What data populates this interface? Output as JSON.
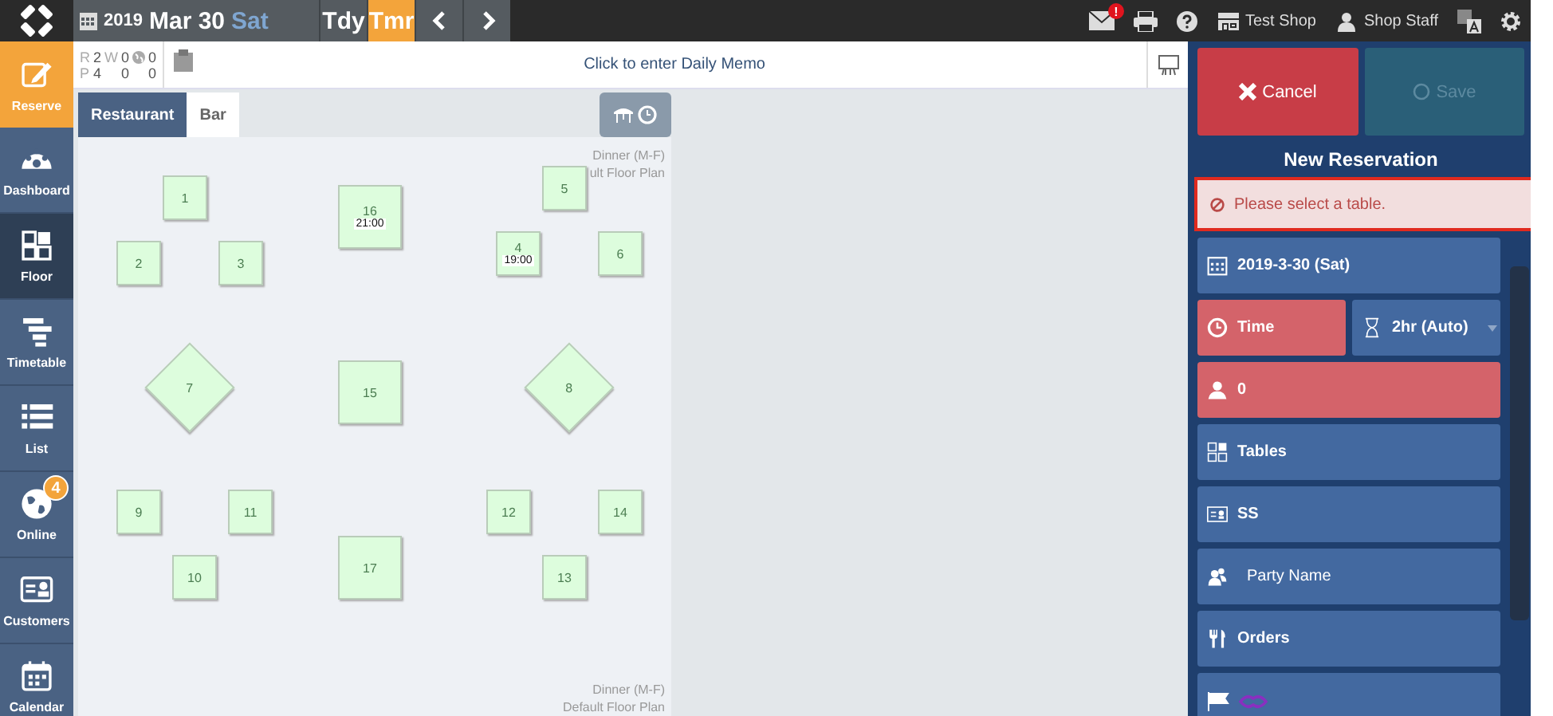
{
  "topbar": {
    "year": "2019",
    "date": "Mar 30",
    "weekday": "Sat",
    "nav": [
      {
        "label": "Tdy",
        "selected": false
      },
      {
        "label": "Tmr",
        "selected": true
      }
    ],
    "mail_badge": "!",
    "shop": "Test Shop",
    "staff": "Shop Staff"
  },
  "sidebar": {
    "reserve": "Reserve",
    "items": [
      {
        "label": "Dashboard",
        "selected": false
      },
      {
        "label": "Floor",
        "selected": true
      },
      {
        "label": "Timetable",
        "selected": false
      },
      {
        "label": "List",
        "selected": false
      },
      {
        "label": "Online",
        "selected": false,
        "badge": "4"
      },
      {
        "label": "Customers",
        "selected": false
      },
      {
        "label": "Calendar",
        "selected": false
      }
    ]
  },
  "stats": {
    "waiting_label": "W",
    "rows": [
      {
        "label": "R",
        "values": [
          "2",
          "0",
          "0"
        ]
      },
      {
        "label": "P",
        "values": [
          "4",
          "0",
          "0"
        ]
      }
    ]
  },
  "memo": {
    "text": "Click to enter Daily Memo"
  },
  "floor_tabs": [
    {
      "label": "Restaurant",
      "selected": true
    },
    {
      "label": "Bar",
      "selected": false
    }
  ],
  "floor_plan": {
    "top_labels": [
      "Dinner (M-F)",
      "ult Floor Plan"
    ],
    "bottom_labels": [
      "Dinner (M-F)",
      "Default Floor Plan"
    ],
    "tables": [
      {
        "label": "1",
        "kind": "square"
      },
      {
        "label": "2",
        "kind": "square"
      },
      {
        "label": "3",
        "kind": "square"
      },
      {
        "label": "16",
        "kind": "large",
        "time": "21:00"
      },
      {
        "label": "5",
        "kind": "square"
      },
      {
        "label": "4",
        "kind": "square",
        "time": "19:00"
      },
      {
        "label": "6",
        "kind": "square"
      },
      {
        "label": "7",
        "kind": "diamond"
      },
      {
        "label": "15",
        "kind": "large"
      },
      {
        "label": "8",
        "kind": "diamond"
      },
      {
        "label": "9",
        "kind": "square"
      },
      {
        "label": "11",
        "kind": "square"
      },
      {
        "label": "12",
        "kind": "square"
      },
      {
        "label": "14",
        "kind": "square"
      },
      {
        "label": "10",
        "kind": "square"
      },
      {
        "label": "17",
        "kind": "large"
      },
      {
        "label": "13",
        "kind": "square"
      }
    ]
  },
  "reservation": {
    "cancel": "Cancel",
    "save": "Save",
    "save_disabled": true,
    "title": "New Reservation",
    "alert": "Please select a table.",
    "fields": [
      {
        "kind": "date",
        "text": "2019-3-30 (Sat)",
        "invalid": false
      },
      {
        "kind": "time",
        "text": "Time",
        "invalid": true,
        "duration": "2hr (Auto)"
      },
      {
        "kind": "people",
        "text": "0",
        "invalid": true
      },
      {
        "kind": "tables",
        "text": "Tables",
        "invalid": false
      },
      {
        "kind": "customer",
        "text": "SS",
        "invalid": false
      },
      {
        "kind": "party",
        "text": "Party Name",
        "invalid": false
      },
      {
        "kind": "orders",
        "text": "Orders",
        "invalid": false
      },
      {
        "kind": "flags",
        "invalid": false
      }
    ]
  }
}
